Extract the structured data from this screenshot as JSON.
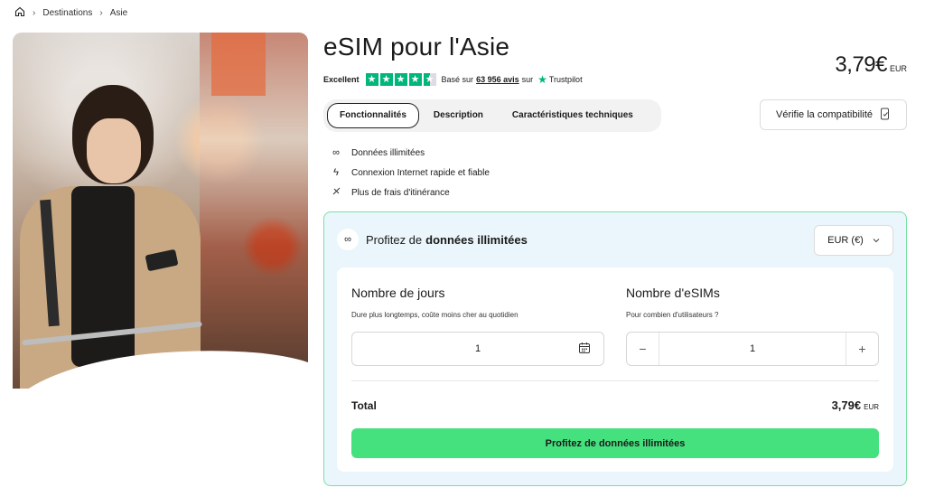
{
  "breadcrumb": {
    "home_icon": "home-icon",
    "items": [
      "Destinations",
      "Asie"
    ]
  },
  "product": {
    "title": "eSIM pour l'Asie",
    "price": "3,79€",
    "price_currency": "EUR"
  },
  "rating": {
    "label": "Excellent",
    "stars": 4.5,
    "based_on": "Basé sur",
    "reviews": "63 956 avis",
    "on": "sur",
    "provider": "Trustpilot"
  },
  "tabs": [
    {
      "label": "Fonctionnalités",
      "active": true
    },
    {
      "label": "Description",
      "active": false
    },
    {
      "label": "Caractéristiques techniques",
      "active": false
    }
  ],
  "compatibility_button": "Vérifie la compatibilité",
  "features": [
    {
      "icon": "infinity-icon",
      "text": "Données illimitées"
    },
    {
      "icon": "lightning-icon",
      "text": "Connexion Internet rapide et fiable"
    },
    {
      "icon": "no-roaming-icon",
      "text": "Plus de frais d'itinérance"
    }
  ],
  "plan_card": {
    "heading_prefix": "Profitez de",
    "heading_bold": "données illimitées",
    "currency_select": "EUR (€)",
    "days": {
      "label": "Nombre de jours",
      "hint": "Dure plus longtemps, coûte moins cher au quotidien",
      "value": "1"
    },
    "esims": {
      "label": "Nombre d'eSIMs",
      "hint": "Pour combien d'utilisateurs ?",
      "value": "1"
    },
    "total_label": "Total",
    "total_value": "3,79€",
    "total_currency": "EUR",
    "cta": "Profitez de données illimitées"
  },
  "colors": {
    "accent": "#45e17f",
    "card_border": "#79e0a3",
    "card_bg": "#eaf6fb",
    "trustpilot": "#00b67a"
  }
}
